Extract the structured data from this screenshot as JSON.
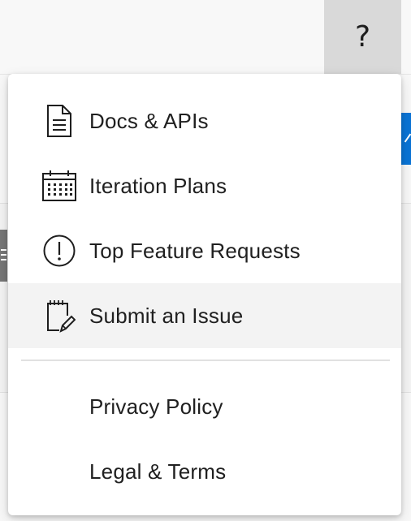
{
  "header": {
    "help_button_label": "?"
  },
  "menu": {
    "items": [
      {
        "label": "Docs & APIs",
        "icon": "document-icon"
      },
      {
        "label": "Iteration Plans",
        "icon": "calendar-icon"
      },
      {
        "label": "Top Feature Requests",
        "icon": "alert-circle-icon"
      },
      {
        "label": "Submit an Issue",
        "icon": "edit-note-icon",
        "hovered": true
      }
    ],
    "secondary_items": [
      {
        "label": "Privacy Policy"
      },
      {
        "label": "Legal & Terms"
      }
    ]
  },
  "colors": {
    "accent_blue": "#0a74d6",
    "hover_background": "#f3f3f3",
    "text": "#202020"
  }
}
